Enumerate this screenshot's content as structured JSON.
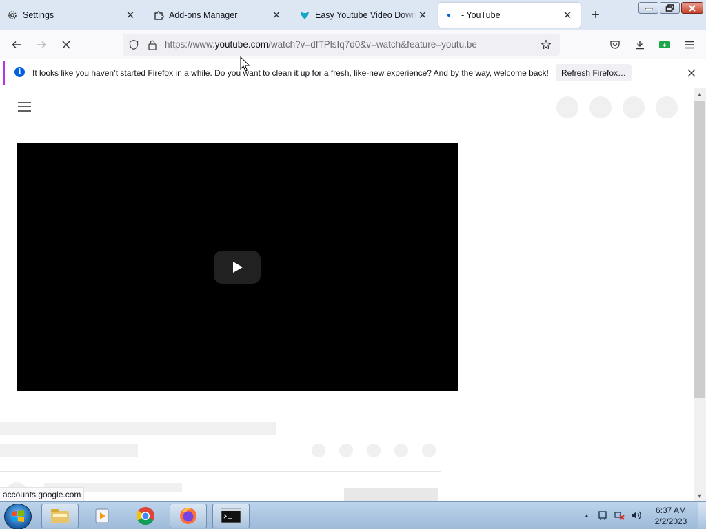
{
  "browser": {
    "tabs": [
      {
        "title": "Settings",
        "icon": "gear-icon",
        "active": false
      },
      {
        "title": "Add-ons Manager",
        "icon": "puzzle-icon",
        "active": false
      },
      {
        "title": "Easy Youtube Video Downloa",
        "icon": "download-fox-icon",
        "active": false
      },
      {
        "title": "- YouTube",
        "icon": "loading-icon",
        "active": true
      }
    ],
    "url": {
      "prefix": "https://www.",
      "domain": "youtube.com",
      "path": "/watch?v=dfTPlsIq7d0&v=watch&feature=youtu.be"
    }
  },
  "notification": {
    "message": "It looks like you haven’t started Firefox in a while. Do you want to clean it up for a fresh, like-new experience? And by the way, welcome back!",
    "button_label": "Refresh Firefox…"
  },
  "status_bar": {
    "text": "accounts.google.com"
  },
  "taskbar": {
    "items": [
      "windows-explorer",
      "media-player",
      "google-chrome",
      "firefox",
      "command-prompt"
    ],
    "clock": {
      "time": "6:37 AM",
      "date": "2/2/2023"
    }
  },
  "colors": {
    "accent": "#0060df",
    "notice_border": "#b833e1",
    "player_bg": "#000000"
  }
}
